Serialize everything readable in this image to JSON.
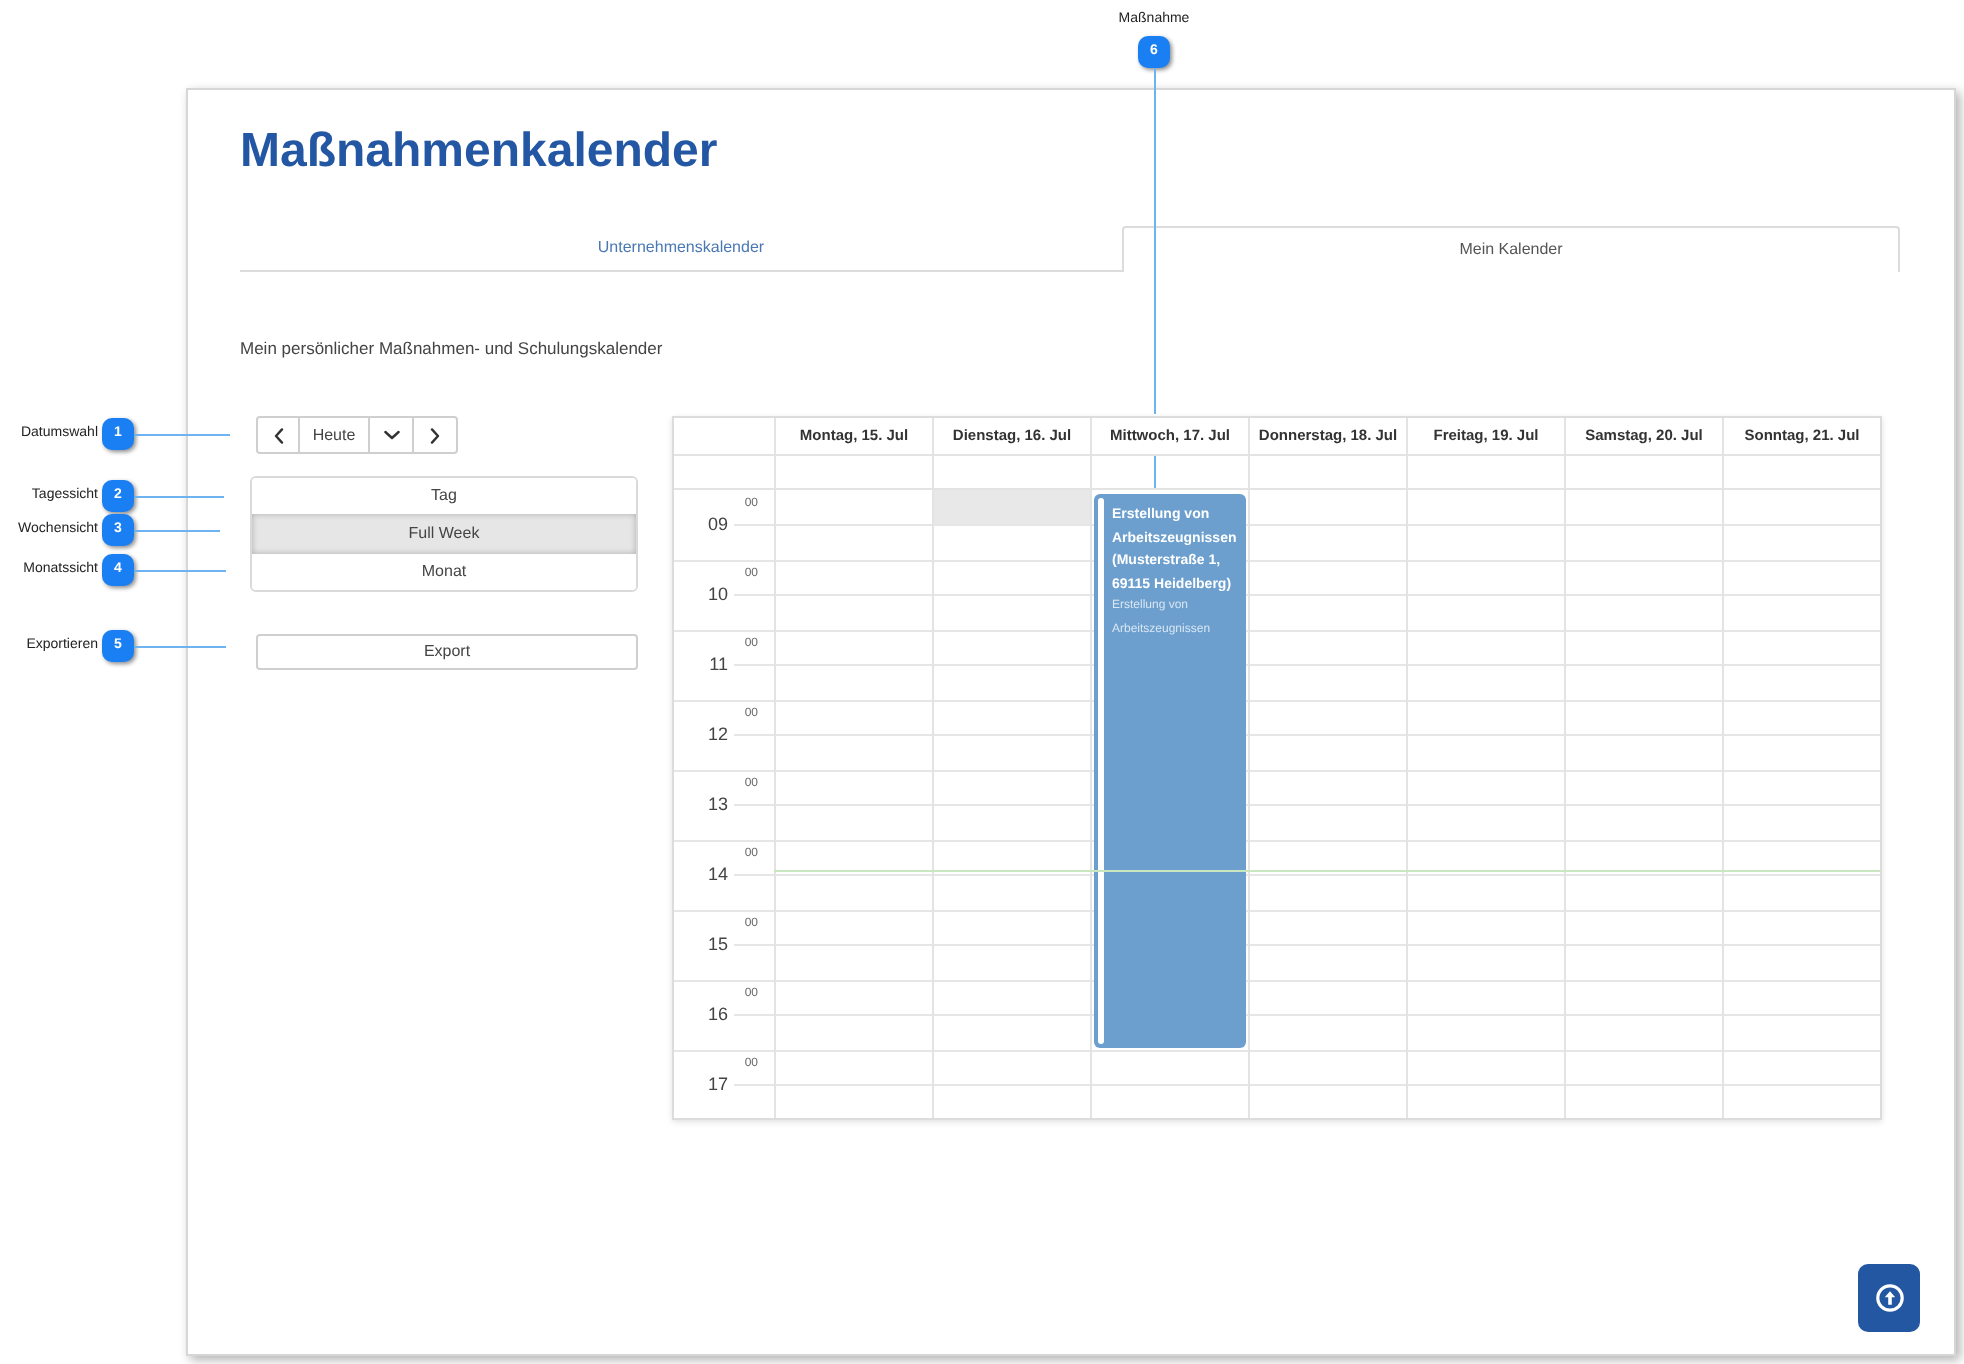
{
  "callouts": [
    {
      "kind": "top",
      "number": "6",
      "label": "Maßnahme"
    },
    {
      "kind": "side",
      "number": "1",
      "label": "Datumswahl"
    },
    {
      "kind": "side",
      "number": "2",
      "label": "Tagessicht"
    },
    {
      "kind": "side",
      "number": "3",
      "label": "Wochensicht"
    },
    {
      "kind": "side",
      "number": "4",
      "label": "Monatssicht"
    },
    {
      "kind": "side",
      "number": "5",
      "label": "Exportieren"
    }
  ],
  "page": {
    "title": "Maßnahmenkalender",
    "tabs": [
      {
        "label": "Unternehmenskalender",
        "selected": false
      },
      {
        "label": "Mein Kalender",
        "selected": true
      }
    ],
    "subtitle": "Mein persönlicher Maßnahmen- und Schulungskalender"
  },
  "date_nav": [
    {
      "kind": "prev"
    },
    {
      "kind": "today",
      "label": "Heute"
    },
    {
      "kind": "dropdown"
    },
    {
      "kind": "next"
    }
  ],
  "view_switch": [
    {
      "label": "Tag",
      "selected": false
    },
    {
      "label": "Full Week",
      "selected": true
    },
    {
      "label": "Monat",
      "selected": false
    }
  ],
  "export_button": {
    "label": "Export"
  },
  "calendar": {
    "days": [
      {
        "label": "Montag, 15. Jul",
        "slot_highlighted": false
      },
      {
        "label": "Dienstag, 16. Jul",
        "slot_highlighted": true
      },
      {
        "label": "Mittwoch, 17. Jul",
        "slot_highlighted": false,
        "events": [
          {
            "title": "Erstellung von Arbeitszeugnissen (Musterstraße 1, 69115 Heidelberg)",
            "description": "Erstellung von Arbeitszeugnissen"
          }
        ]
      },
      {
        "label": "Donnerstag, 18. Jul",
        "slot_highlighted": false
      },
      {
        "label": "Freitag, 19. Jul",
        "slot_highlighted": false
      },
      {
        "label": "Samstag, 20. Jul",
        "slot_highlighted": false
      },
      {
        "label": "Sonntag, 21. Jul",
        "slot_highlighted": false
      }
    ],
    "hours": [
      {
        "label": "09",
        "minutes": "00",
        "current": false
      },
      {
        "label": "10",
        "minutes": "00",
        "current": false
      },
      {
        "label": "11",
        "minutes": "00",
        "current": false
      },
      {
        "label": "12",
        "minutes": "00",
        "current": false
      },
      {
        "label": "13",
        "minutes": "00",
        "current": false
      },
      {
        "label": "14",
        "minutes": "00",
        "current": true
      },
      {
        "label": "15",
        "minutes": "00",
        "current": false
      },
      {
        "label": "16",
        "minutes": "00",
        "current": false
      },
      {
        "label": "17",
        "minutes": "00",
        "current": false
      }
    ]
  }
}
